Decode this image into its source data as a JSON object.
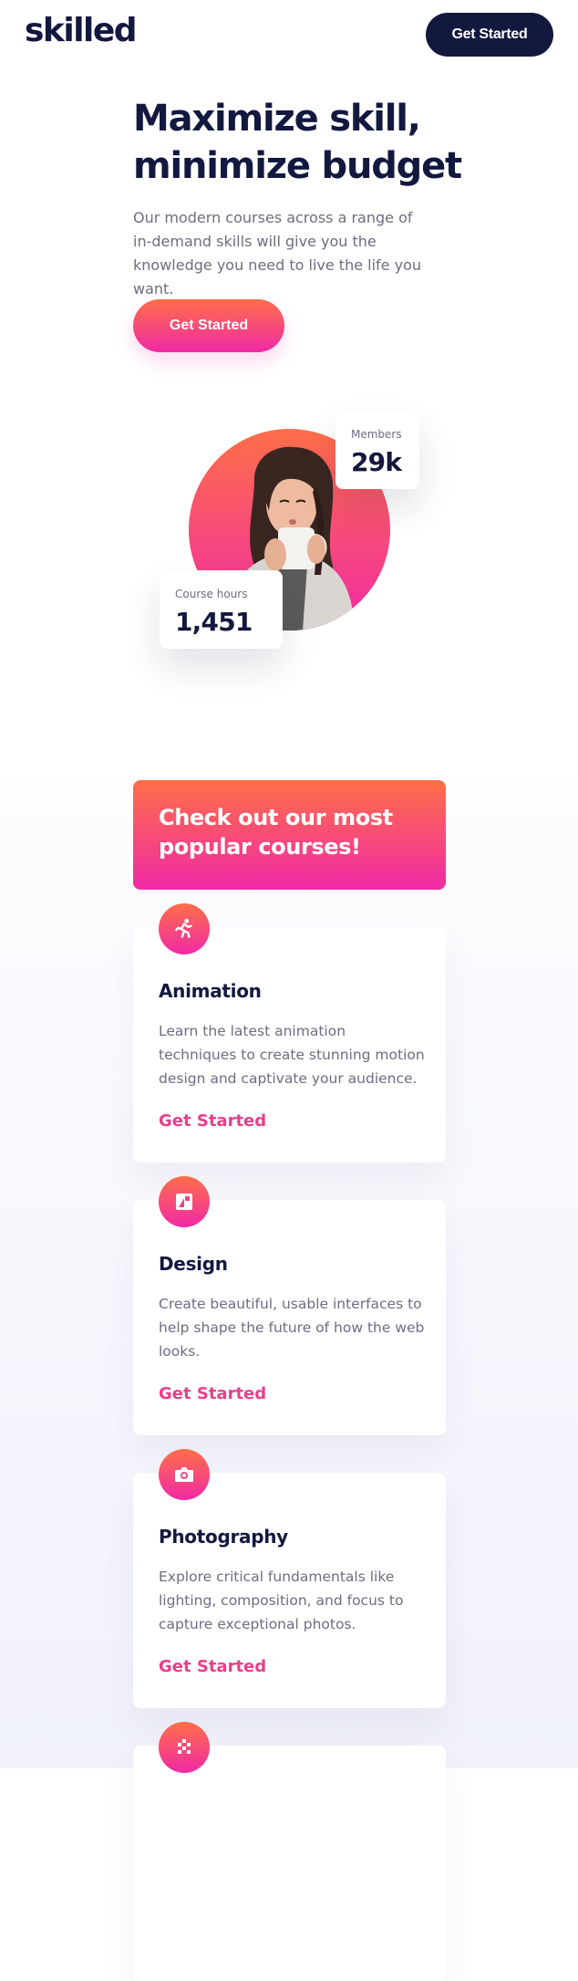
{
  "header": {
    "logo": "skilled",
    "cta_label": "Get Started"
  },
  "hero": {
    "title": "Maximize skill, minimize budget",
    "description": "Our modern courses across a range of in-demand skills will give you the knowledge you need to live the life you want.",
    "cta_label": "Get Started",
    "stats": {
      "members_label": "Members",
      "members_value": "29k",
      "hours_label": "Course hours",
      "hours_value": "1,451"
    }
  },
  "courses": {
    "banner_title": "Check out our most popular courses!",
    "items": [
      {
        "icon": "running-person-icon",
        "title": "Animation",
        "description": "Learn the latest animation techniques to create stunning motion design and captivate your audience.",
        "link_label": "Get Started"
      },
      {
        "icon": "design-icon",
        "title": "Design",
        "description": "Create beautiful, usable interfaces to help shape the future of how the web looks.",
        "link_label": "Get Started"
      },
      {
        "icon": "camera-icon",
        "title": "Photography",
        "description": "Explore critical fundamentals like lighting, composition, and focus to capture exceptional photos.",
        "link_label": "Get Started"
      },
      {
        "icon": "crypto-icon"
      }
    ]
  },
  "colors": {
    "navy": "#13183f",
    "gray_text": "#6c6d80",
    "gradient_start": "#ff6f48",
    "gradient_end": "#f02aa6",
    "link_pink": "#e83e8c"
  }
}
